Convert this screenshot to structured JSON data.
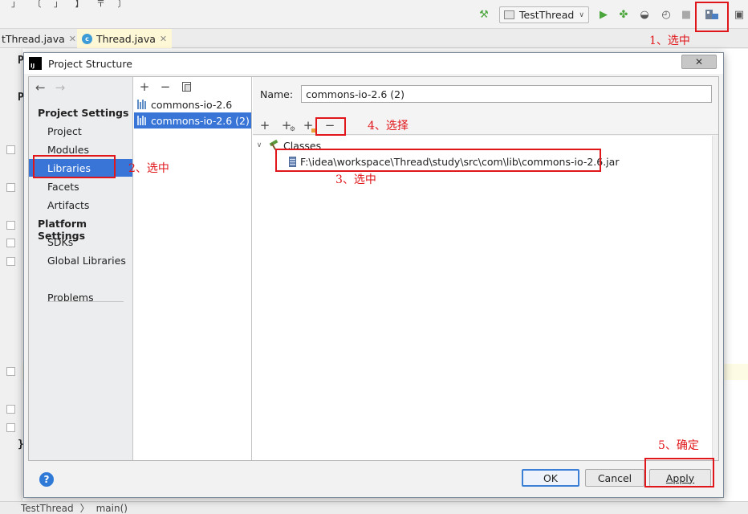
{
  "ide": {
    "top_glyphs": "」 〔 」 】 〒 〕",
    "run_config": "TestThread",
    "tabs": [
      {
        "label": "tThread.java"
      },
      {
        "label": "Thread.java",
        "icon_letter": "c"
      }
    ],
    "status": {
      "left": "TestThread",
      "sep": "〉",
      "right": "main()"
    },
    "code_brace": "}",
    "code_letter_p1": "P",
    "code_letter_p2": "P"
  },
  "dialog": {
    "title": "Project Structure",
    "logo_text": "IJ",
    "close_glyph": "✕",
    "nav": {
      "back_glyph": "←",
      "forward_glyph": "→",
      "project_settings": "Project Settings",
      "project_items": [
        "Project",
        "Modules",
        "Libraries",
        "Facets",
        "Artifacts"
      ],
      "platform_settings": "Platform Settings",
      "platform_items": [
        "SDKs",
        "Global Libraries"
      ],
      "problems": "Problems"
    },
    "libraries": [
      "commons-io-2.6",
      "commons-io-2.6 (2)"
    ],
    "detail": {
      "name_label": "Name:",
      "name_value": "commons-io-2.6 (2)",
      "classes_label": "Classes",
      "jar_path": "F:\\idea\\workspace\\Thread\\study\\src\\com\\lib\\commons-io-2.6.jar"
    },
    "buttons": {
      "ok": "OK",
      "cancel": "Cancel",
      "apply": "Apply",
      "help": "?"
    }
  },
  "annotations": {
    "step1": "1、选中",
    "step2": "2、选中",
    "step3": "3、选中",
    "step4": "4、选择",
    "step5": "5、确定"
  },
  "colors": {
    "selection": "#3875d7",
    "annotation_red": "#e0161a",
    "run_green": "#4aa53a"
  }
}
